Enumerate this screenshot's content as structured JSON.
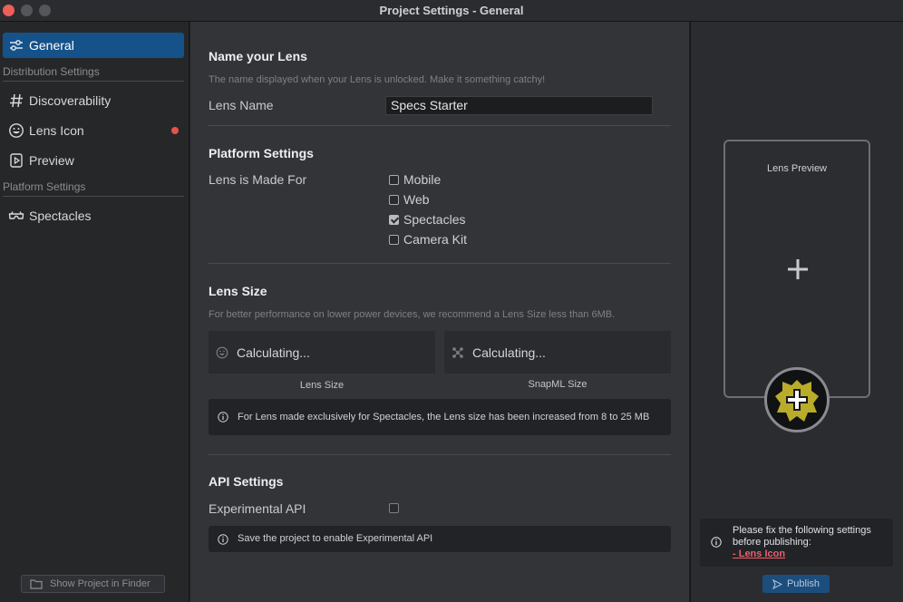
{
  "window": {
    "title": "Project Settings - General"
  },
  "sidebar": {
    "items": [
      {
        "label": "General",
        "icon": "sliders-icon",
        "active": true
      },
      {
        "label": "Discoverability",
        "icon": "hash-icon"
      },
      {
        "label": "Lens Icon",
        "icon": "smiley-icon",
        "has_alert": true
      },
      {
        "label": "Preview",
        "icon": "play-icon"
      },
      {
        "label": "Spectacles",
        "icon": "spectacles-icon"
      }
    ],
    "sections": [
      "Distribution Settings",
      "Platform Settings"
    ],
    "finder_button": "Show Project in Finder"
  },
  "main": {
    "name": {
      "title": "Name your Lens",
      "hint": "The name displayed when your Lens is unlocked. Make it something catchy!",
      "label": "Lens Name",
      "value": "Specs Starter"
    },
    "platform": {
      "title": "Platform Settings",
      "label": "Lens is Made For",
      "options": [
        {
          "label": "Mobile",
          "checked": false
        },
        {
          "label": "Web",
          "checked": false
        },
        {
          "label": "Spectacles",
          "checked": true
        },
        {
          "label": "Camera Kit",
          "checked": false
        }
      ]
    },
    "size": {
      "title": "Lens Size",
      "hint": "For better performance on lower power devices, we recommend a Lens Size less than 6MB.",
      "lens_size_value": "Calculating...",
      "lens_size_caption": "Lens Size",
      "snapml_value": "Calculating...",
      "snapml_caption": "SnapML Size",
      "info": "For Lens made exclusively for Spectacles, the Lens size has been increased from 8 to 25 MB"
    },
    "api": {
      "title": "API Settings",
      "label": "Experimental API",
      "checked": false,
      "info": "Save the project to enable Experimental API"
    }
  },
  "right": {
    "preview_label": "Lens Preview",
    "warning_text": "Please fix the following settings before publishing:",
    "warning_link": "- Lens Icon",
    "publish_label": "Publish"
  },
  "colors": {
    "accent": "#15528a",
    "alert": "#e5534b",
    "link": "#ec5f6b",
    "icon_yellow": "#d7c82e"
  }
}
